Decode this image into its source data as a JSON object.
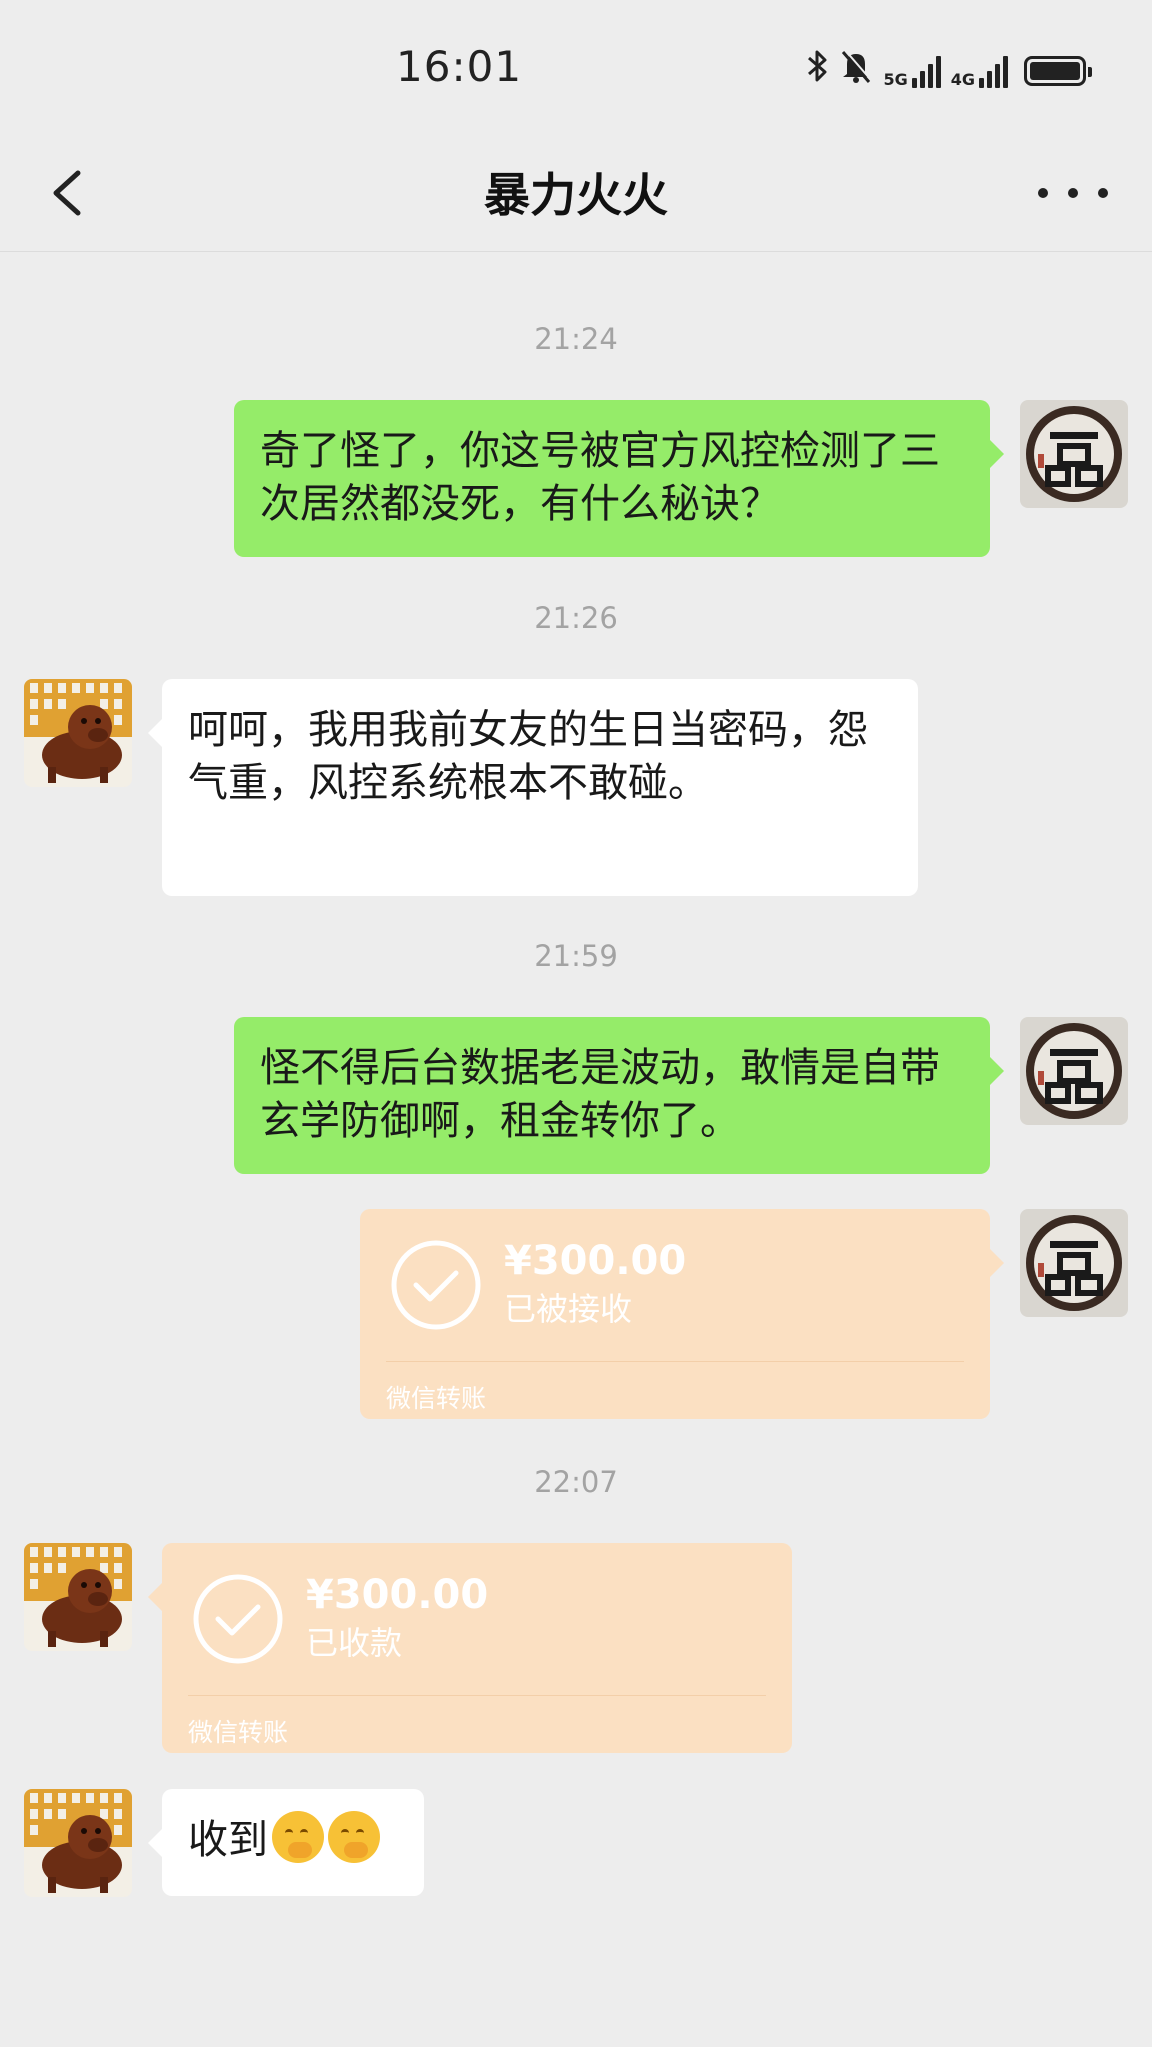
{
  "status_bar": {
    "time": "16:01",
    "icons": [
      "bluetooth-icon",
      "mute-icon",
      "5g-signal-icon",
      "4g-signal-icon",
      "battery-icon"
    ],
    "signal_5g_label": "5G",
    "signal_4g_label": "4G"
  },
  "nav": {
    "title": "暴力火火",
    "back_icon": "chevron-left-icon",
    "more_icon": "more-icon"
  },
  "messages": [
    {
      "type": "timestamp",
      "text": "21:24"
    },
    {
      "type": "text",
      "from": "me",
      "text": "奇了怪了，你这号被官方风控检测了三次居然都没死，有什么秘诀？"
    },
    {
      "type": "timestamp",
      "text": "21:26"
    },
    {
      "type": "text",
      "from": "other",
      "text": "呵呵，我用我前女友的生日当密码，怨气重，风控系统根本不敢碰。"
    },
    {
      "type": "timestamp",
      "text": "21:59"
    },
    {
      "type": "text",
      "from": "me",
      "text": "怪不得后台数据老是波动，敢情是自带玄学防御啊，租金转你了。"
    },
    {
      "type": "transfer",
      "from": "me",
      "amount": "¥300.00",
      "status": "已被接收",
      "footer": "微信转账"
    },
    {
      "type": "timestamp",
      "text": "22:07"
    },
    {
      "type": "transfer",
      "from": "other",
      "amount": "¥300.00",
      "status": "已收款",
      "footer": "微信转账"
    },
    {
      "type": "text",
      "from": "other",
      "text": "收到",
      "emoji": [
        "hand-over-mouth-emoji",
        "hand-over-mouth-emoji"
      ]
    }
  ],
  "colors": {
    "background": "#ededed",
    "my_bubble": "#95ec69",
    "other_bubble": "#ffffff",
    "transfer_card": "#fbe0c2",
    "timestamp": "#a3a3a3"
  }
}
